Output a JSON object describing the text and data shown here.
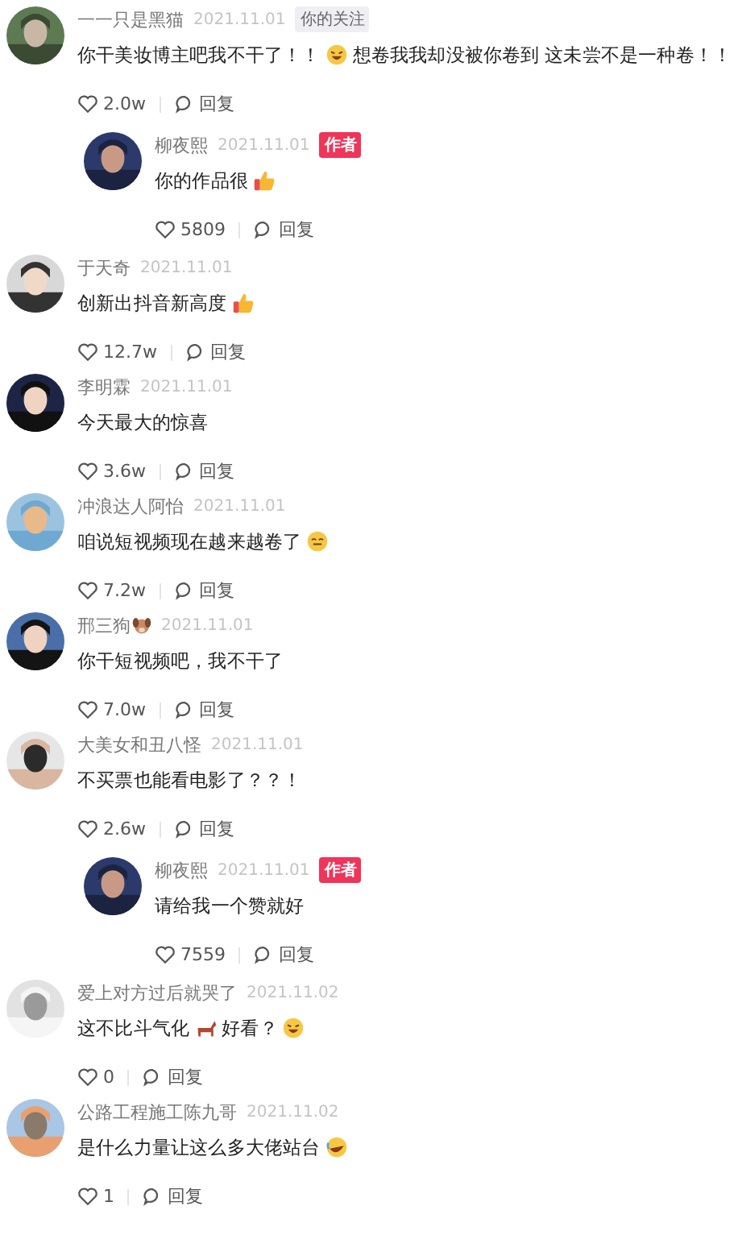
{
  "comments": [
    {
      "reply": false,
      "name": "一一只是黑猫",
      "date": "2021.11.01",
      "badge": {
        "kind": "follow",
        "text": "你的关注"
      },
      "content": [
        {
          "kind": "text",
          "text": "你干美妆博主吧我不干了！！"
        },
        {
          "kind": "laugh"
        },
        {
          "kind": "text",
          "text": "想卷我我却没被你卷到 这未尝不是一种卷！！"
        }
      ],
      "likes": "2.0w",
      "reply_label": "回复"
    },
    {
      "reply": true,
      "name": "柳夜熙",
      "date": "2021.11.01",
      "badge": {
        "kind": "author",
        "text": "作者"
      },
      "content": [
        {
          "kind": "text",
          "text": "你的作品很"
        },
        {
          "kind": "thumbs"
        }
      ],
      "likes": "5809",
      "reply_label": "回复"
    },
    {
      "reply": false,
      "name": "于天奇",
      "date": "2021.11.01",
      "content": [
        {
          "kind": "text",
          "text": "创新出抖音新高度"
        },
        {
          "kind": "thumbs"
        }
      ],
      "likes": "12.7w",
      "reply_label": "回复"
    },
    {
      "reply": false,
      "name": "李明霖",
      "date": "2021.11.01",
      "content": [
        {
          "kind": "text",
          "text": "今天最大的惊喜"
        }
      ],
      "likes": "3.6w",
      "reply_label": "回复"
    },
    {
      "reply": false,
      "name": "冲浪达人阿怡",
      "date": "2021.11.01",
      "content": [
        {
          "kind": "text",
          "text": "咱说短视频现在越来越卷了"
        },
        {
          "kind": "sweat"
        }
      ],
      "likes": "7.2w",
      "reply_label": "回复"
    },
    {
      "reply": false,
      "name": "邢三狗",
      "name_icon": {
        "kind": "dog"
      },
      "date": "2021.11.01",
      "content": [
        {
          "kind": "text",
          "text": "你干短视频吧，我不干了"
        }
      ],
      "likes": "7.0w",
      "reply_label": "回复"
    },
    {
      "reply": false,
      "name": "大美女和丑八怪",
      "date": "2021.11.01",
      "content": [
        {
          "kind": "text",
          "text": "不买票也能看电影了？？！"
        }
      ],
      "likes": "2.6w",
      "reply_label": "回复"
    },
    {
      "reply": true,
      "name": "柳夜熙",
      "date": "2021.11.01",
      "badge": {
        "kind": "author",
        "text": "作者"
      },
      "content": [
        {
          "kind": "text",
          "text": "请给我一个赞就好"
        }
      ],
      "likes": "7559",
      "reply_label": "回复"
    },
    {
      "reply": false,
      "name": "爱上对方过后就哭了",
      "date": "2021.11.02",
      "content": [
        {
          "kind": "text",
          "text": "这不比斗气化"
        },
        {
          "kind": "horse"
        },
        {
          "kind": "text",
          "text": "好看？"
        },
        {
          "kind": "laugh"
        }
      ],
      "likes": "0",
      "reply_label": "回复"
    },
    {
      "reply": false,
      "name": "公路工程施工陈九哥",
      "date": "2021.11.02",
      "content": [
        {
          "kind": "text",
          "text": "是什么力量让这么多大佬站台"
        },
        {
          "kind": "rofl"
        }
      ],
      "likes": "1",
      "reply_label": "回复"
    }
  ]
}
